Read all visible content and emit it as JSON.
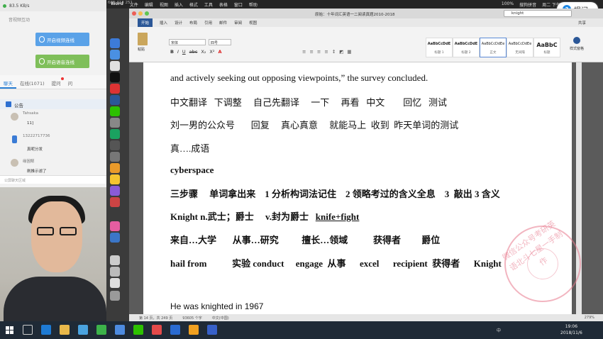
{
  "live_panel": {
    "network_speed": "83.5 KB/s",
    "section_title": "音视频互动",
    "video_button": "开启视频连线",
    "voice_button": "开启语音连线",
    "tabs": [
      "聊天",
      "在线(1071)",
      "提问",
      "问"
    ],
    "announcement": "公告",
    "chats": [
      {
        "name": "Tahsaka",
        "text": "11]"
      },
      {
        "name": "13222717736",
        "text": "真呢分发"
      },
      {
        "name": "缘困鲸",
        "text": "刷推示滤了"
      }
    ],
    "input_hint": "公屏聊天区域"
  },
  "mac_menu": {
    "meeting_id": "685 413 251",
    "items": [
      "Word",
      "文件",
      "编辑",
      "视图",
      "插入",
      "格式",
      "工具",
      "表格",
      "窗口",
      "帮助"
    ],
    "status_right": [
      "100%",
      "搜狗拼音",
      "周二 下午"
    ]
  },
  "ask_button": "提问",
  "word": {
    "doc_title": "原始：十年词汇英语一二阅读真题2010-2018",
    "search_value": "knight",
    "tabs": [
      "开始",
      "插入",
      "设计",
      "布局",
      "引用",
      "邮件",
      "审阅",
      "视图"
    ],
    "share": "共享",
    "paste_label": "粘贴",
    "font_name": "宋体",
    "font_size": "四号",
    "format_buttons": [
      "B",
      "I",
      "U",
      "abc",
      "X₂",
      "X²",
      "A"
    ],
    "styles": [
      {
        "sample": "AaBbCcDdE",
        "name": "标题 1"
      },
      {
        "sample": "AaBbCcDdE",
        "name": "标题 2"
      },
      {
        "sample": "AaBbCcDdEe",
        "name": "正文"
      },
      {
        "sample": "AaBbCcDdEe",
        "name": "无间隔"
      },
      {
        "sample": "AaBbC",
        "name": "标题"
      }
    ],
    "styles_pane": "样式窗格",
    "statusbar": {
      "page": "第 14 页，共 249 页",
      "words": "93605 个字",
      "lang": "中文(中国)",
      "zoom": "279%"
    }
  },
  "document_lines": [
    "and actively seeking out opposing viewpoints,” the survey concluded.",
    "中文翻译   下调整     自己先翻译     一下     再看   中文        回忆   测试",
    "刘一男的公众号       回复     真心真意     就能马上  收到  昨天单词的测试",
    "真….成语",
    "cyberspace",
    "三步骤     单词拿出来    1 分析构词法记住    2 领略考过的含义全息    3  敲出 3 含义",
    "Knight n.武士；爵士     v.封为爵士   ",
    "knife+fight",
    "来自…大学       从事…研究          擅长…领域           获得者         爵位",
    "hail from           实验 conduct     engage  从事      excel      recipient  获得者      Knight",
    "He was knighted in 1967"
  ],
  "stamp_text": "微信公众号考研英语北斗七星一手制作",
  "taskbar": {
    "time": "19:06",
    "date": "2018/11/6",
    "tray": "中"
  },
  "colors": {
    "word_blue": "#2b5797",
    "stamp": "#e7788c",
    "video_btn": "#5aa2e8",
    "voice_btn": "#7fbf5a"
  }
}
